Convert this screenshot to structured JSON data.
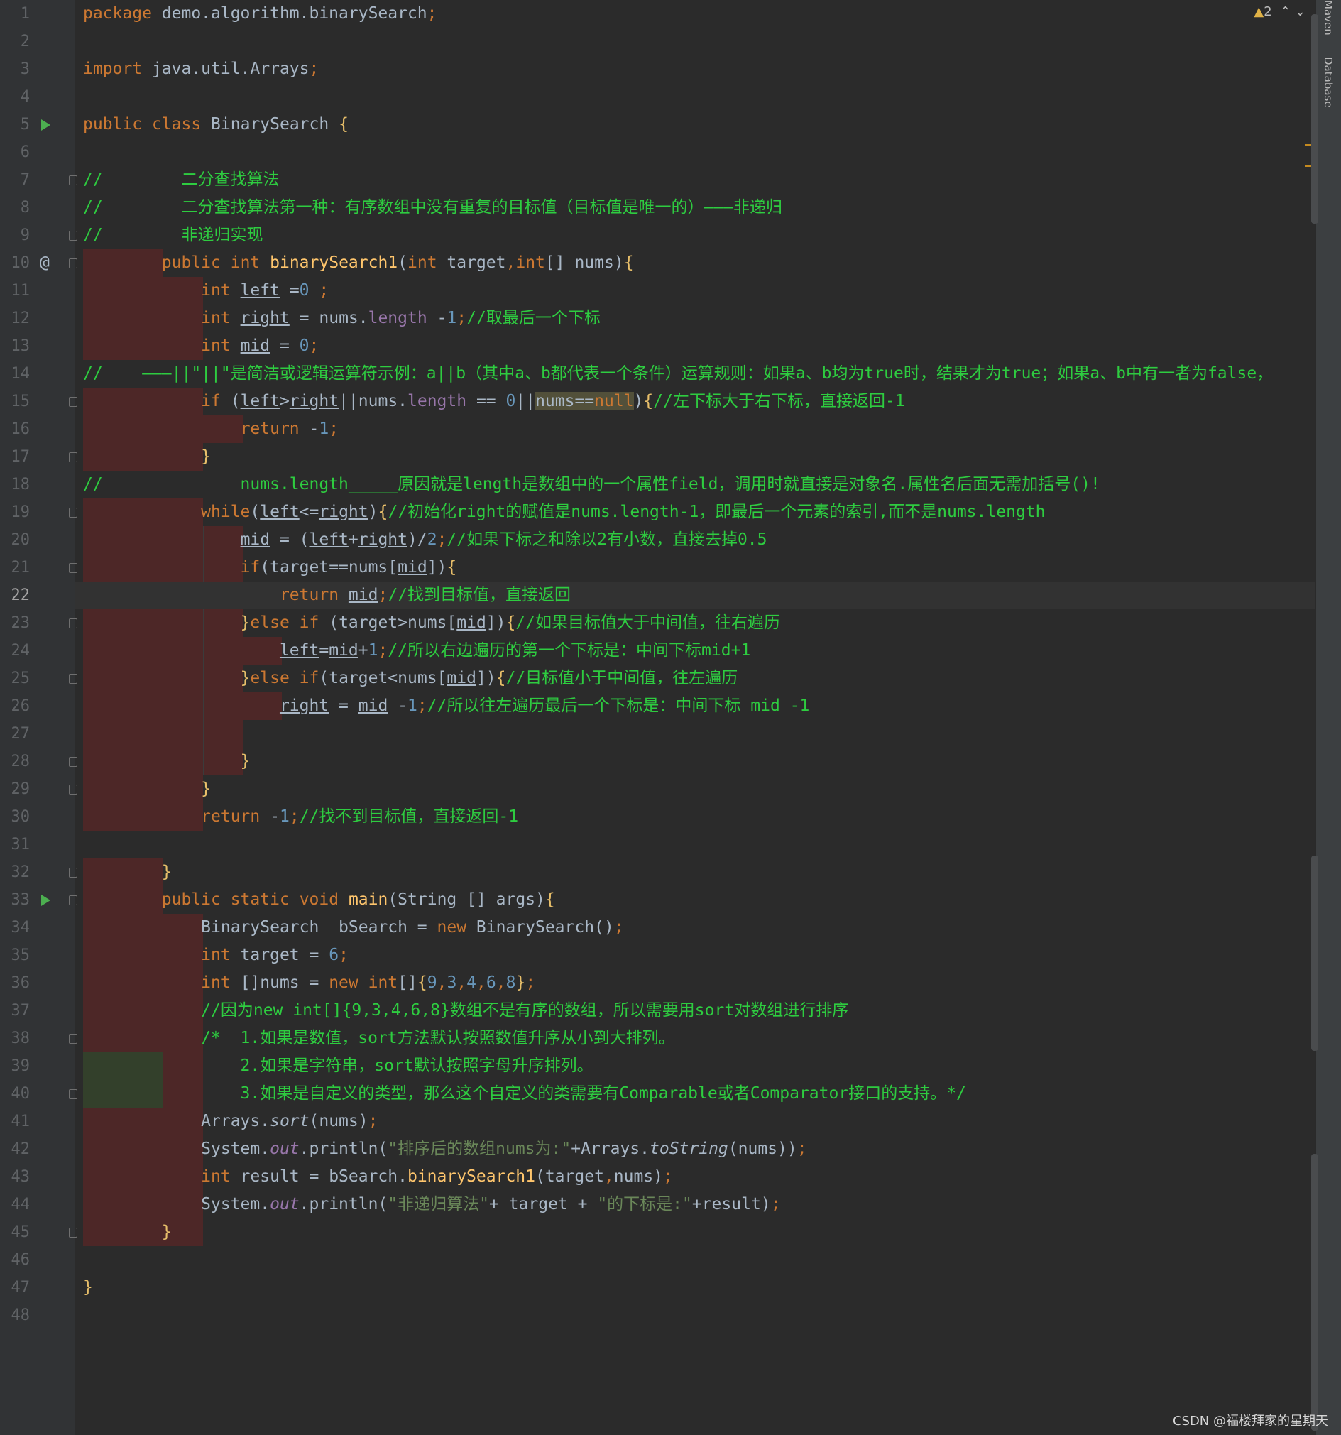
{
  "editor": {
    "current_line": 22,
    "line_numbers": [
      "1",
      "2",
      "3",
      "4",
      "5",
      "6",
      "7",
      "8",
      "9",
      "10",
      "11",
      "12",
      "13",
      "14",
      "15",
      "16",
      "17",
      "18",
      "19",
      "20",
      "21",
      "22",
      "23",
      "24",
      "25",
      "26",
      "27",
      "28",
      "29",
      "30",
      "31",
      "32",
      "33",
      "34",
      "35",
      "36",
      "37",
      "38",
      "39",
      "40",
      "41",
      "42",
      "43",
      "44",
      "45",
      "46",
      "47",
      "48"
    ],
    "lines": [
      {
        "t": "package demo.algorithm.binarySearch;"
      },
      {
        "t": ""
      },
      {
        "t": "import java.util.Arrays;"
      },
      {
        "t": ""
      },
      {
        "t": "public class BinarySearch {"
      },
      {
        "t": ""
      },
      {
        "t": "//        二分查找算法"
      },
      {
        "t": "//        二分查找算法第一种：有序数组中没有重复的目标值（目标值是唯一的）———非递归"
      },
      {
        "t": "//        非递归实现"
      },
      {
        "t": "        public int binarySearch1(int target,int[] nums){"
      },
      {
        "t": "            int left =0 ;"
      },
      {
        "t": "            int right = nums.length -1;//取最后一个下标"
      },
      {
        "t": "            int mid = 0;"
      },
      {
        "t": "//    ———||\"||\"是简洁或逻辑运算符示例：a||b（其中a、b都代表一个条件）运算规则：如果a、b均为true时，结果才为true；如果a、b中有一者为false，"
      },
      {
        "t": "            if (left>right||nums.length == 0||nums==null){//左下标大于右下标，直接返回-1"
      },
      {
        "t": "                return -1;"
      },
      {
        "t": "            }"
      },
      {
        "t": "//              nums.length_____原因就是length是数组中的一个属性field，调用时就直接是对象名.属性名后面无需加括号()!"
      },
      {
        "t": "            while(left<=right){//初始化right的赋值是nums.length-1，即最后一个元素的索引,而不是nums.length"
      },
      {
        "t": "                mid = (left+right)/2;//如果下标之和除以2有小数，直接去掉0.5"
      },
      {
        "t": "                if(target==nums[mid]){"
      },
      {
        "t": "                    return mid;//找到目标值，直接返回"
      },
      {
        "t": "                }else if (target>nums[mid]){//如果目标值大于中间值，往右遍历"
      },
      {
        "t": "                    left=mid+1;//所以右边遍历的第一个下标是：中间下标mid+1"
      },
      {
        "t": "                }else if(target<nums[mid]){//目标值小于中间值，往左遍历"
      },
      {
        "t": "                    right = mid -1;//所以往左遍历最后一个下标是：中间下标 mid -1"
      },
      {
        "t": ""
      },
      {
        "t": "                }"
      },
      {
        "t": "            }"
      },
      {
        "t": "            return -1;//找不到目标值，直接返回-1"
      },
      {
        "t": ""
      },
      {
        "t": "        }"
      },
      {
        "t": "        public static void main(String [] args){"
      },
      {
        "t": "            BinarySearch  bSearch = new BinarySearch();"
      },
      {
        "t": "            int target = 6;"
      },
      {
        "t": "            int []nums = new int[]{9,3,4,6,8};"
      },
      {
        "t": "            //因为new int[]{9,3,4,6,8}数组不是有序的数组，所以需要用sort对数组进行排序"
      },
      {
        "t": "            /*  1.如果是数值，sort方法默认按照数值升序从小到大排列。"
      },
      {
        "t": "                2.如果是字符串，sort默认按照字母升序排列。"
      },
      {
        "t": "                3.如果是自定义的类型，那么这个自定义的类需要有Comparable或者Comparator接口的支持。*/"
      },
      {
        "t": "            Arrays.sort(nums);"
      },
      {
        "t": "            System.out.println(\"排序后的数组nums为:\"+Arrays.toString(nums));"
      },
      {
        "t": "            int result = bSearch.binarySearch1(target,nums);"
      },
      {
        "t": "            System.out.println(\"非递归算法\"+ target + \"的下标是:\"+result);"
      },
      {
        "t": "        }"
      },
      {
        "t": ""
      },
      {
        "t": "}"
      },
      {
        "t": ""
      }
    ]
  },
  "inspections": {
    "warning_count": "2"
  },
  "side_tabs": {
    "maven": "Maven",
    "database": "Database"
  },
  "watermark": "CSDN @福楼拜家的星期天",
  "icons": {
    "run": "run-icon",
    "override": "at-icon",
    "fold": "fold-marker-icon",
    "warning": "warning-icon"
  },
  "colors": {
    "background": "#2b2b2b",
    "keyword": "#cc7832",
    "comment": "#2ecc40",
    "string": "#6a8759",
    "number": "#6897bb",
    "method": "#ffc66d",
    "field": "#9876aa"
  }
}
